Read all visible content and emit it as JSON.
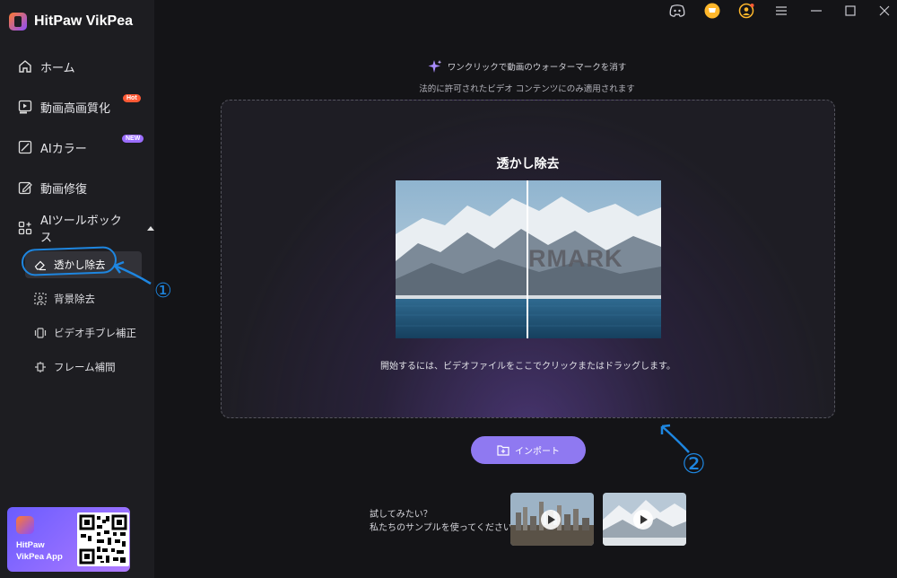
{
  "app": {
    "name": "HitPaw VikPea"
  },
  "sidebar": {
    "items": [
      {
        "label": "ホーム",
        "icon": "home-icon"
      },
      {
        "label": "動画高画質化",
        "icon": "video-uhd-icon",
        "badge": "Hot"
      },
      {
        "label": "AIカラー",
        "icon": "colorize-icon",
        "badge": "NEW"
      },
      {
        "label": "動画修復",
        "icon": "repair-icon"
      },
      {
        "label": "AIツールボックス",
        "icon": "toolbox-icon"
      }
    ],
    "subitems": [
      {
        "label": "透かし除去",
        "icon": "eraser-icon",
        "active": true
      },
      {
        "label": "背景除去",
        "icon": "bg-remove-icon"
      },
      {
        "label": "ビデオ手ブレ補正",
        "icon": "stabilize-icon"
      },
      {
        "label": "フレーム補間",
        "icon": "frame-interp-icon"
      }
    ],
    "promo": {
      "line1": "HitPaw",
      "line2": "VikPea App"
    }
  },
  "topbar": {
    "icons": [
      "discord-icon",
      "cart-icon",
      "account-icon",
      "menu-icon",
      "minimize-icon",
      "maximize-icon",
      "close-icon"
    ]
  },
  "main": {
    "headline": "ワンクリックで動画のウォーターマークを消す",
    "subline": "法的に許可されたビデオ コンテンツにのみ適用されます",
    "dropzone": {
      "title": "透かし除去",
      "watermark_text": "RMARK",
      "hint": "開始するには、ビデオファイルをここでクリックまたはドラッグします。"
    },
    "import_label": "インポート",
    "try": {
      "line1": "試してみたい？",
      "line2": "私たちのサンプルを使ってください"
    },
    "annotations": [
      "①",
      "②"
    ]
  },
  "colors": {
    "accent": "#8f79f1",
    "annotation": "#1e86e0",
    "hot": "#ff5a36",
    "new": "#9b6dff"
  }
}
